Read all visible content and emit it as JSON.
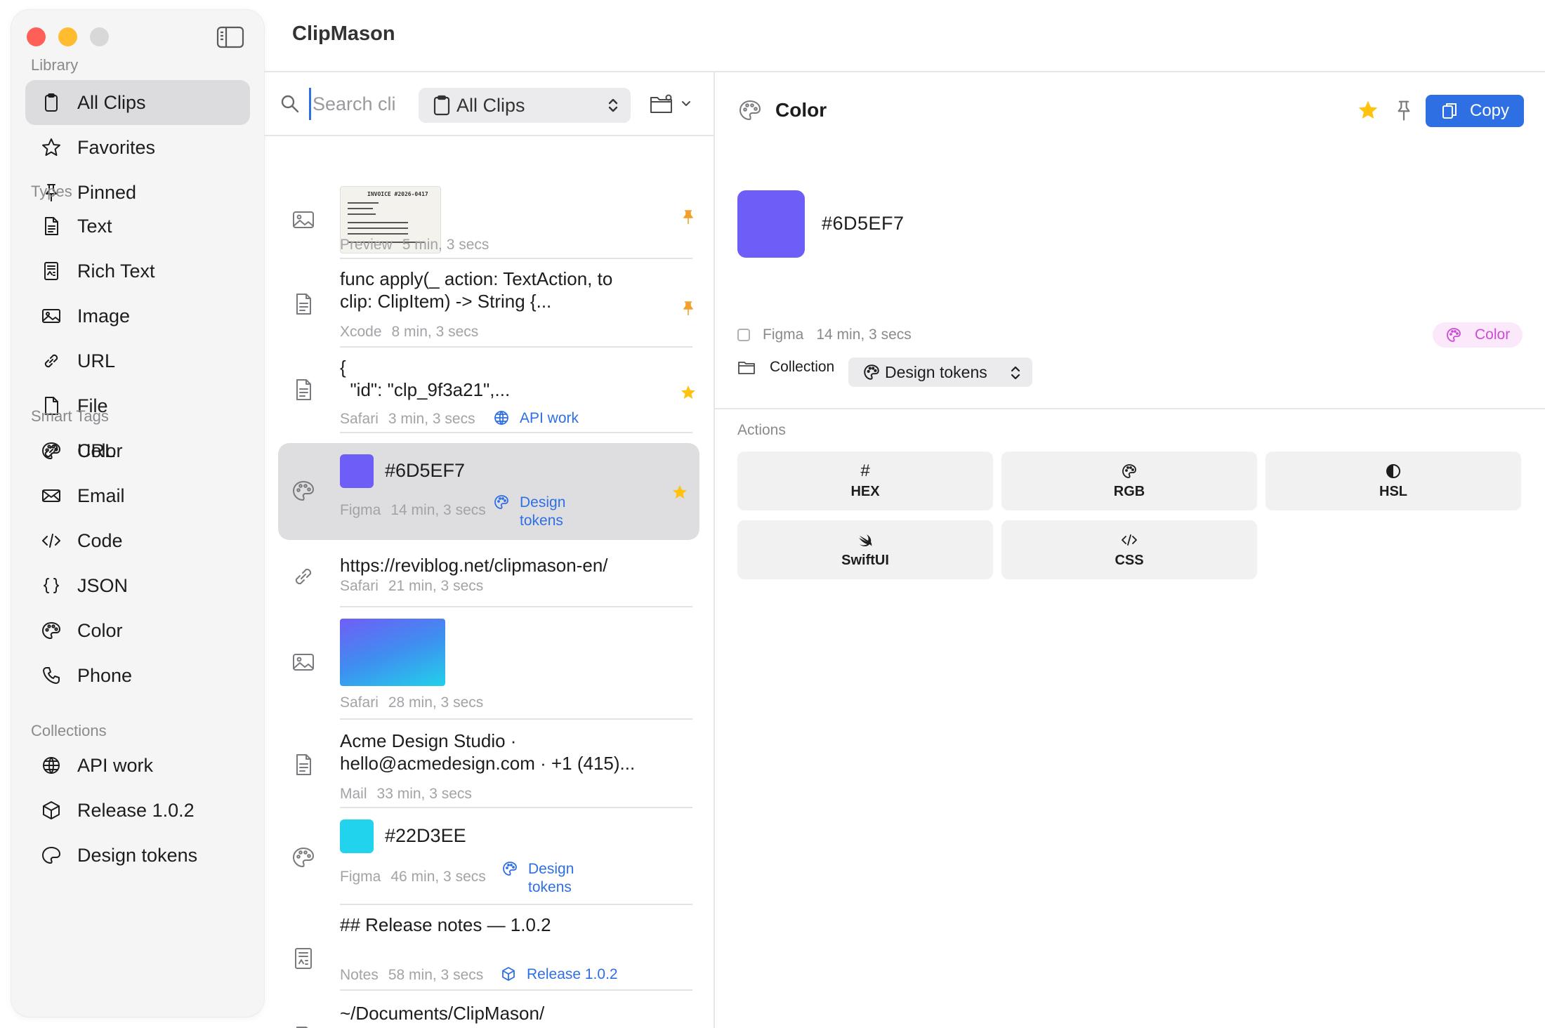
{
  "app": {
    "title": "ClipMason"
  },
  "sidebar": {
    "sections": [
      {
        "header": "Library",
        "items": [
          {
            "label": "All Clips",
            "icon": "clipboard-icon",
            "selected": true
          },
          {
            "label": "Favorites",
            "icon": "star-icon"
          },
          {
            "label": "Pinned",
            "icon": "pin-icon"
          }
        ]
      },
      {
        "header": "Types",
        "items": [
          {
            "label": "Text",
            "icon": "document-icon"
          },
          {
            "label": "Rich Text",
            "icon": "rich-text-icon"
          },
          {
            "label": "Image",
            "icon": "image-icon"
          },
          {
            "label": "URL",
            "icon": "link-icon"
          },
          {
            "label": "File",
            "icon": "file-icon"
          },
          {
            "label": "Color",
            "icon": "palette-icon"
          }
        ]
      },
      {
        "header": "Smart Tags",
        "items": [
          {
            "label": "URL",
            "icon": "link-icon"
          },
          {
            "label": "Email",
            "icon": "envelope-icon"
          },
          {
            "label": "Code",
            "icon": "code-icon"
          },
          {
            "label": "JSON",
            "icon": "braces-icon"
          },
          {
            "label": "Color",
            "icon": "palette-icon"
          },
          {
            "label": "Phone",
            "icon": "phone-icon"
          }
        ]
      },
      {
        "header": "Collections",
        "items": [
          {
            "label": "API work",
            "icon": "globe-icon"
          },
          {
            "label": "Release 1.0.2",
            "icon": "cube-icon"
          },
          {
            "label": "Design tokens",
            "icon": "palette-icon"
          }
        ]
      }
    ]
  },
  "list": {
    "search_placeholder": "Search clips",
    "filter_label": "All Clips",
    "clips": [
      {
        "type": "image",
        "thumb_title": "INVOICE #2026-0417",
        "app": "Preview",
        "age": "5 min, 3 secs",
        "flag": "pinned"
      },
      {
        "type": "text",
        "text": "func apply(_ action: TextAction, to clip: ClipItem) -> String {...",
        "app": "Xcode",
        "age": "8 min, 3 secs",
        "flag": "pinned"
      },
      {
        "type": "text",
        "text": "{\n  \"id\": \"clp_9f3a21\",...",
        "app": "Safari",
        "age": "3 min, 3 secs",
        "tag": "API work",
        "flag": "favorite"
      },
      {
        "type": "color",
        "text": "#6D5EF7",
        "app": "Figma",
        "age": "14 min, 3 secs",
        "tag": "Design tokens",
        "flag": "favorite",
        "selected": true
      },
      {
        "type": "url",
        "text": "https://reviblog.net/clipmason-en/",
        "app": "Safari",
        "age": "21 min, 3 secs"
      },
      {
        "type": "image",
        "app": "Safari",
        "age": "28 min, 3 secs"
      },
      {
        "type": "text",
        "text": "Acme Design Studio · hello@acmedesign.com · +1 (415)...",
        "app": "Mail",
        "age": "33 min, 3 secs"
      },
      {
        "type": "color",
        "text": "#22D3EE",
        "app": "Figma",
        "age": "46 min, 3 secs",
        "tag": "Design tokens"
      },
      {
        "type": "rich-text",
        "text": "## Release notes — 1.0.2",
        "app": "Notes",
        "age": "58 min, 3 secs",
        "tag": "Release 1.0.2"
      },
      {
        "type": "file",
        "text": "~/Documents/ClipMason/"
      }
    ]
  },
  "detail": {
    "title": "Color",
    "copy_label": "Copy",
    "hex": "#6D5EF7",
    "app": "Figma",
    "age": "14 min, 3 secs",
    "type_pill": "Color",
    "collection_label": "Collection",
    "collection_value": "Design tokens",
    "actions_label": "Actions",
    "actions": [
      {
        "label": "HEX",
        "icon": "hash-icon"
      },
      {
        "label": "RGB",
        "icon": "palette-icon"
      },
      {
        "label": "HSL",
        "icon": "half-circle-icon"
      },
      {
        "label": "SwiftUI",
        "icon": "swift-icon"
      },
      {
        "label": "CSS",
        "icon": "code-icon"
      }
    ]
  },
  "colors": {
    "accent": "#2F6FE4",
    "selected_swatch": "#6D5EF7",
    "second_swatch": "#22D3EE",
    "star": "#FFC20E",
    "pin": "#F2A02B",
    "pill_text": "#C94ED1"
  }
}
